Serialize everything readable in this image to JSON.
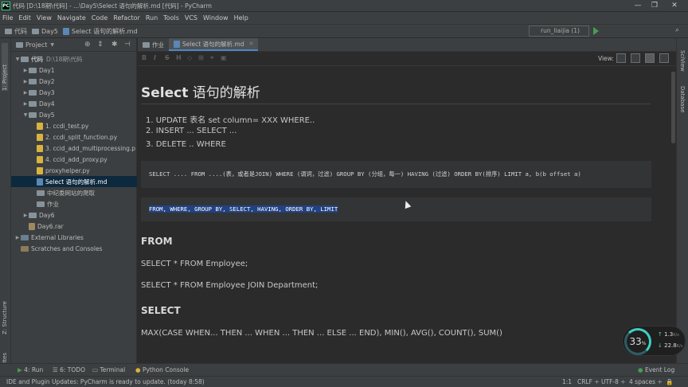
{
  "window": {
    "title": "代码 [D:\\18期\\代码] - ...\\Day5\\Select 语句的解析.md [代码] - PyCharm",
    "app_icon": "PC",
    "controls": [
      "—",
      "❐",
      "✕"
    ]
  },
  "menu": [
    "File",
    "Edit",
    "View",
    "Navigate",
    "Code",
    "Refactor",
    "Run",
    "Tools",
    "VCS",
    "Window",
    "Help"
  ],
  "breadcrumbs": [
    "代码",
    "Day5",
    "Select 语句的解析.md"
  ],
  "run_config": "run_liaijia (1)",
  "left_strip": {
    "project": "1: Project",
    "structure": "Z: Structure",
    "favorites": "2: Favorites"
  },
  "right_strip": {
    "sciview": "SciView",
    "database": "Database"
  },
  "project_panel": {
    "header": "Project",
    "root": {
      "name": "代码",
      "path": "D:\\18期\\代码"
    },
    "items": [
      {
        "label": "Day1",
        "type": "folder",
        "depth": 1,
        "expanded": false
      },
      {
        "label": "Day2",
        "type": "folder",
        "depth": 1,
        "expanded": false
      },
      {
        "label": "Day3",
        "type": "folder",
        "depth": 1,
        "expanded": false
      },
      {
        "label": "Day4",
        "type": "folder",
        "depth": 1,
        "expanded": false
      },
      {
        "label": "Day5",
        "type": "folder",
        "depth": 1,
        "expanded": true
      },
      {
        "label": "1. ccdi_test.py",
        "type": "py",
        "depth": 2
      },
      {
        "label": "2. ccdi_split_function.py",
        "type": "py",
        "depth": 2
      },
      {
        "label": "3. ccid_add_multiprocessing.p",
        "type": "py",
        "depth": 2
      },
      {
        "label": "4. ccid_add_proxy.py",
        "type": "py",
        "depth": 2
      },
      {
        "label": "proxyhelper.py",
        "type": "py",
        "depth": 2
      },
      {
        "label": "Select 语句的解析.md",
        "type": "md",
        "depth": 2,
        "selected": true
      },
      {
        "label": "中纪委网站的爬取",
        "type": "folder",
        "depth": 2
      },
      {
        "label": "作业",
        "type": "folder",
        "depth": 2
      },
      {
        "label": "Day6",
        "type": "folder",
        "depth": 1,
        "expanded": false
      },
      {
        "label": "Day6.rar",
        "type": "file",
        "depth": 1
      },
      {
        "label": "External Libraries",
        "type": "lib",
        "depth": 0,
        "expanded": false
      },
      {
        "label": "Scratches and Consoles",
        "type": "scratch",
        "depth": 0
      }
    ]
  },
  "editor_tabs": [
    {
      "label": "作业",
      "active": false
    },
    {
      "label": "Select 语句的解析.md",
      "active": true
    }
  ],
  "md_toolbar": {
    "view_label": "View:"
  },
  "document": {
    "title_en": "Select",
    "title_cn": " 语句的解析",
    "list": [
      "1.  UPDATE 表名 set column= XXX WHERE..",
      "2.  INSERT ... SELECT ...",
      "3.  DELETE .. WHERE"
    ],
    "code1": "SELECT .... FROM ....(表，或者是JOIN) WHERE (谓词，过滤) GROUP BY (分组，每一) HAVING (过滤) ORDER BY(排序) LIMIT a, b(b offset a)",
    "code2": "FROM, WHERE, GROUP BY, SELECT, HAVING, ORDER BY, LIMIT",
    "h_from": "FROM",
    "p_from1": "SELECT * FROM Employee;",
    "p_from2": "SELECT * FROM Employee JOIN Department;",
    "h_select": "SELECT",
    "p_select1": "MAX(CASE WHEN... THEN ... WHEN ... THEN ... ELSE ... END), MIN(), AVG(), COUNT(), SUM()"
  },
  "bottom_tabs": [
    "4: Run",
    "6: TODO",
    "Terminal",
    "Python Console"
  ],
  "event_log": "Event Log",
  "status": {
    "message": "IDE and Plugin Updates: PyCharm is ready to update. (today 8:58)",
    "position": "1:1",
    "line_sep": "CRLF ÷",
    "encoding": "UTF-8 ÷",
    "indent": "4 spaces ÷"
  },
  "net_widget": {
    "percent": "33",
    "unit": "%",
    "up": "1.3",
    "up_unit": "K/s",
    "down": "22.8",
    "down_unit": "K/s"
  }
}
